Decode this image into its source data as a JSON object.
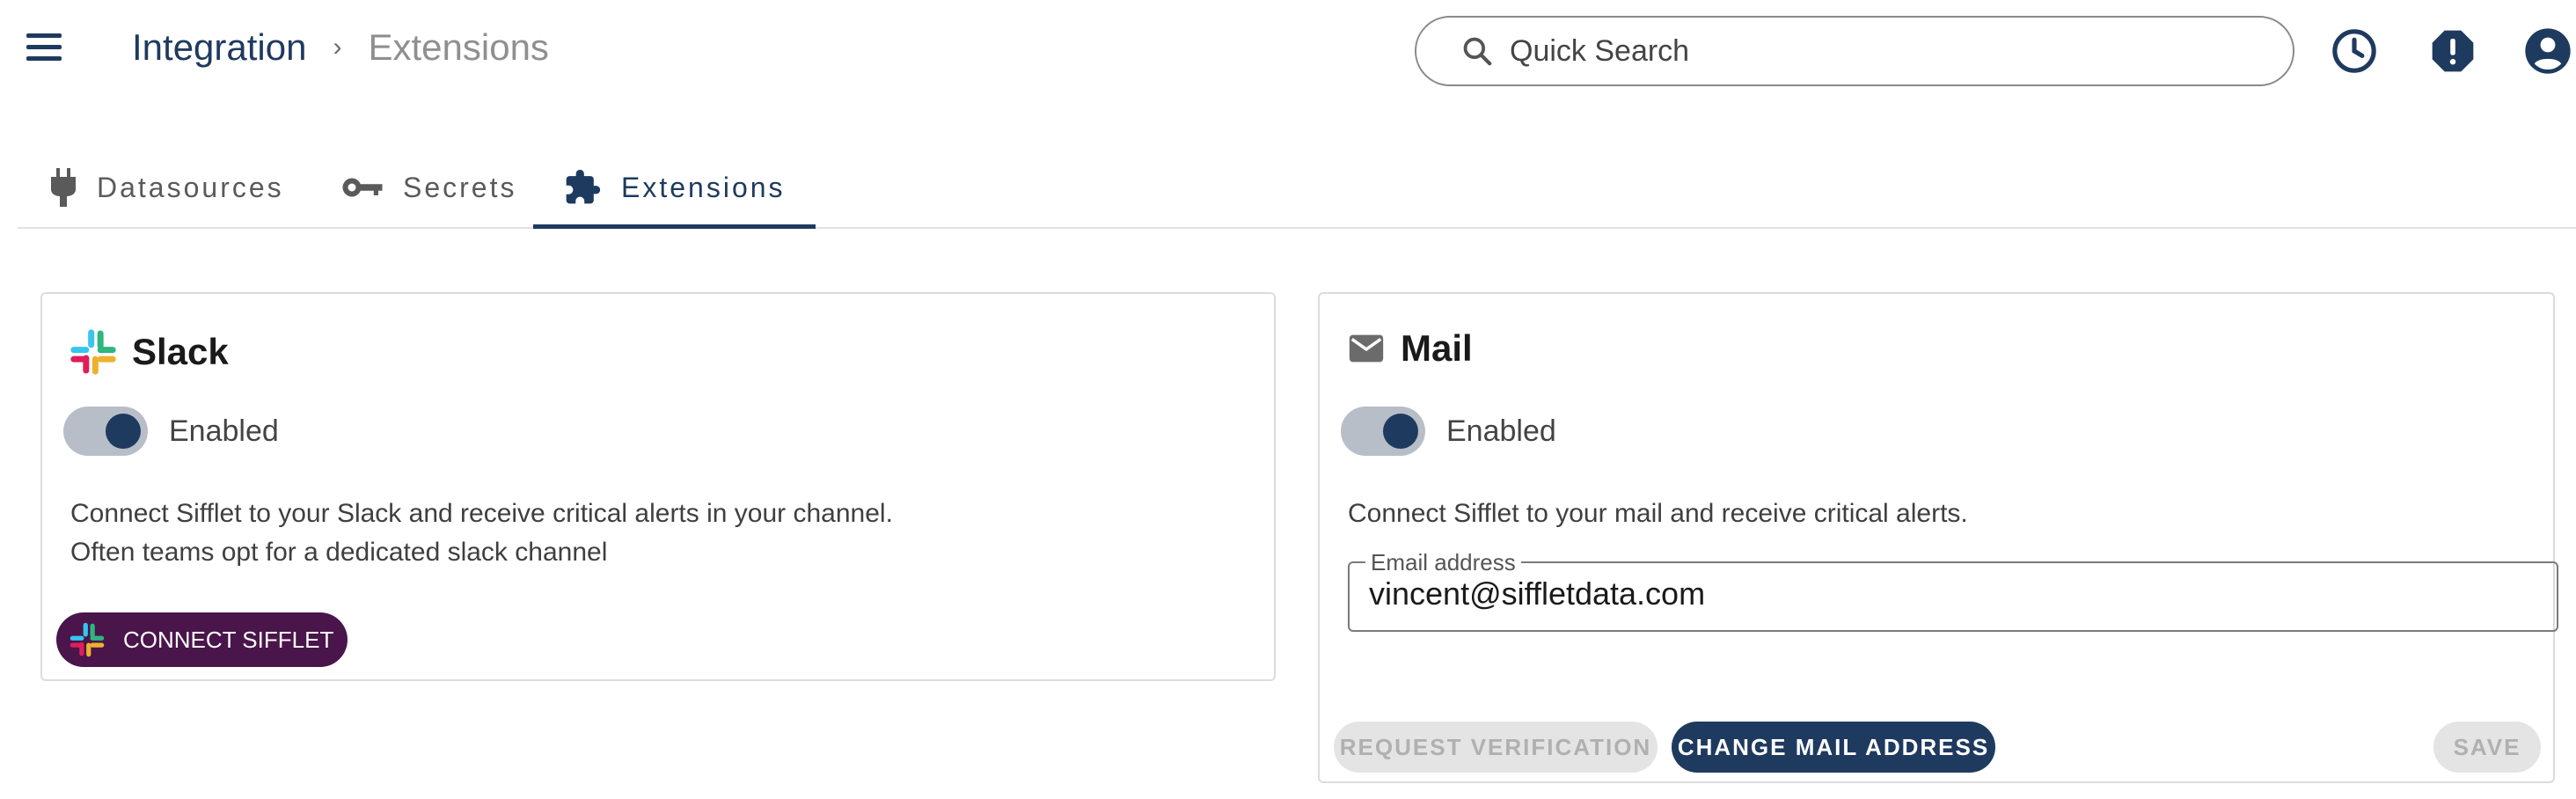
{
  "header": {
    "breadcrumb_root": "Integration",
    "breadcrumb_separator": "›",
    "breadcrumb_current": "Extensions",
    "search_placeholder": "Quick Search",
    "icons": [
      "menu-icon",
      "search-icon",
      "history-icon",
      "alert-icon",
      "account-icon"
    ]
  },
  "tabs": [
    {
      "label": "Datasources",
      "icon": "plug-icon",
      "active": false
    },
    {
      "label": "Secrets",
      "icon": "key-icon",
      "active": false
    },
    {
      "label": "Extensions",
      "icon": "puzzle-icon",
      "active": true
    }
  ],
  "slack": {
    "title": "Slack",
    "toggle_label": "Enabled",
    "enabled": true,
    "description_line1": "Connect Sifflet to your Slack and receive critical alerts in your channel.",
    "description_line2": "Often teams opt for a dedicated slack channel",
    "connect_label": "CONNECT SIFFLET"
  },
  "mail": {
    "title": "Mail",
    "toggle_label": "Enabled",
    "enabled": true,
    "description": "Connect Sifflet to your mail and receive critical alerts.",
    "email_label": "Email address",
    "email_value": "vincent@siffletdata.com",
    "request_verification_label": "REQUEST VERIFICATION",
    "change_mail_label": "CHANGE MAIL ADDRESS",
    "save_label": "SAVE"
  },
  "colors": {
    "primary": "#1f3a5f",
    "slack_button": "#4a154b",
    "disabled_bg": "#e4e4e4",
    "disabled_text": "#b0b0b0"
  }
}
